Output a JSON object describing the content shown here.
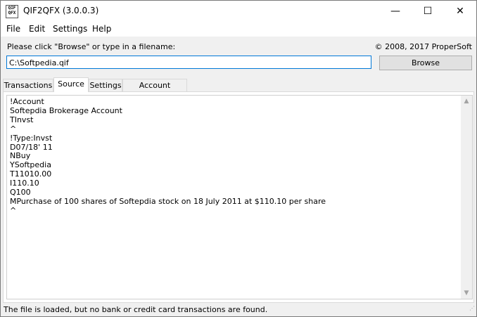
{
  "window": {
    "title": "QIF2QFX (3.0.0.3)",
    "icon_text": [
      "QIF",
      "QFX"
    ],
    "controls": {
      "minimize": "—",
      "maximize": "☐",
      "close": "✕"
    }
  },
  "menu": [
    "File",
    "Edit",
    "Settings",
    "Help"
  ],
  "header": {
    "prompt": "Please click \"Browse\" or type in a filename:",
    "copyright": "© 2008, 2017 ProperSoft"
  },
  "file": {
    "value": "C:\\Softpedia.qif",
    "browse_label": "Browse"
  },
  "tabs": [
    {
      "label": "Transactions",
      "active": false
    },
    {
      "label": "Source",
      "active": true
    },
    {
      "label": "Settings",
      "active": false
    },
    {
      "label": "Account Mapping",
      "active": false
    }
  ],
  "source_text": "!Account\nSoftepdia Brokerage Account\nTInvst\n^\n!Type:Invst\nD07/18' 11\nNBuy\nYSoftpedia\nT11010.00\nI110.10\nQ100\nMPurchase of 100 shares of Softepdia stock on 18 July 2011 at $110.10 per share\n^",
  "status": "The file is loaded, but no bank or credit card transactions are found.",
  "colors": {
    "accent": "#0078d7",
    "titlebar": "#ffffff",
    "window_bg": "#f0f0f0"
  }
}
